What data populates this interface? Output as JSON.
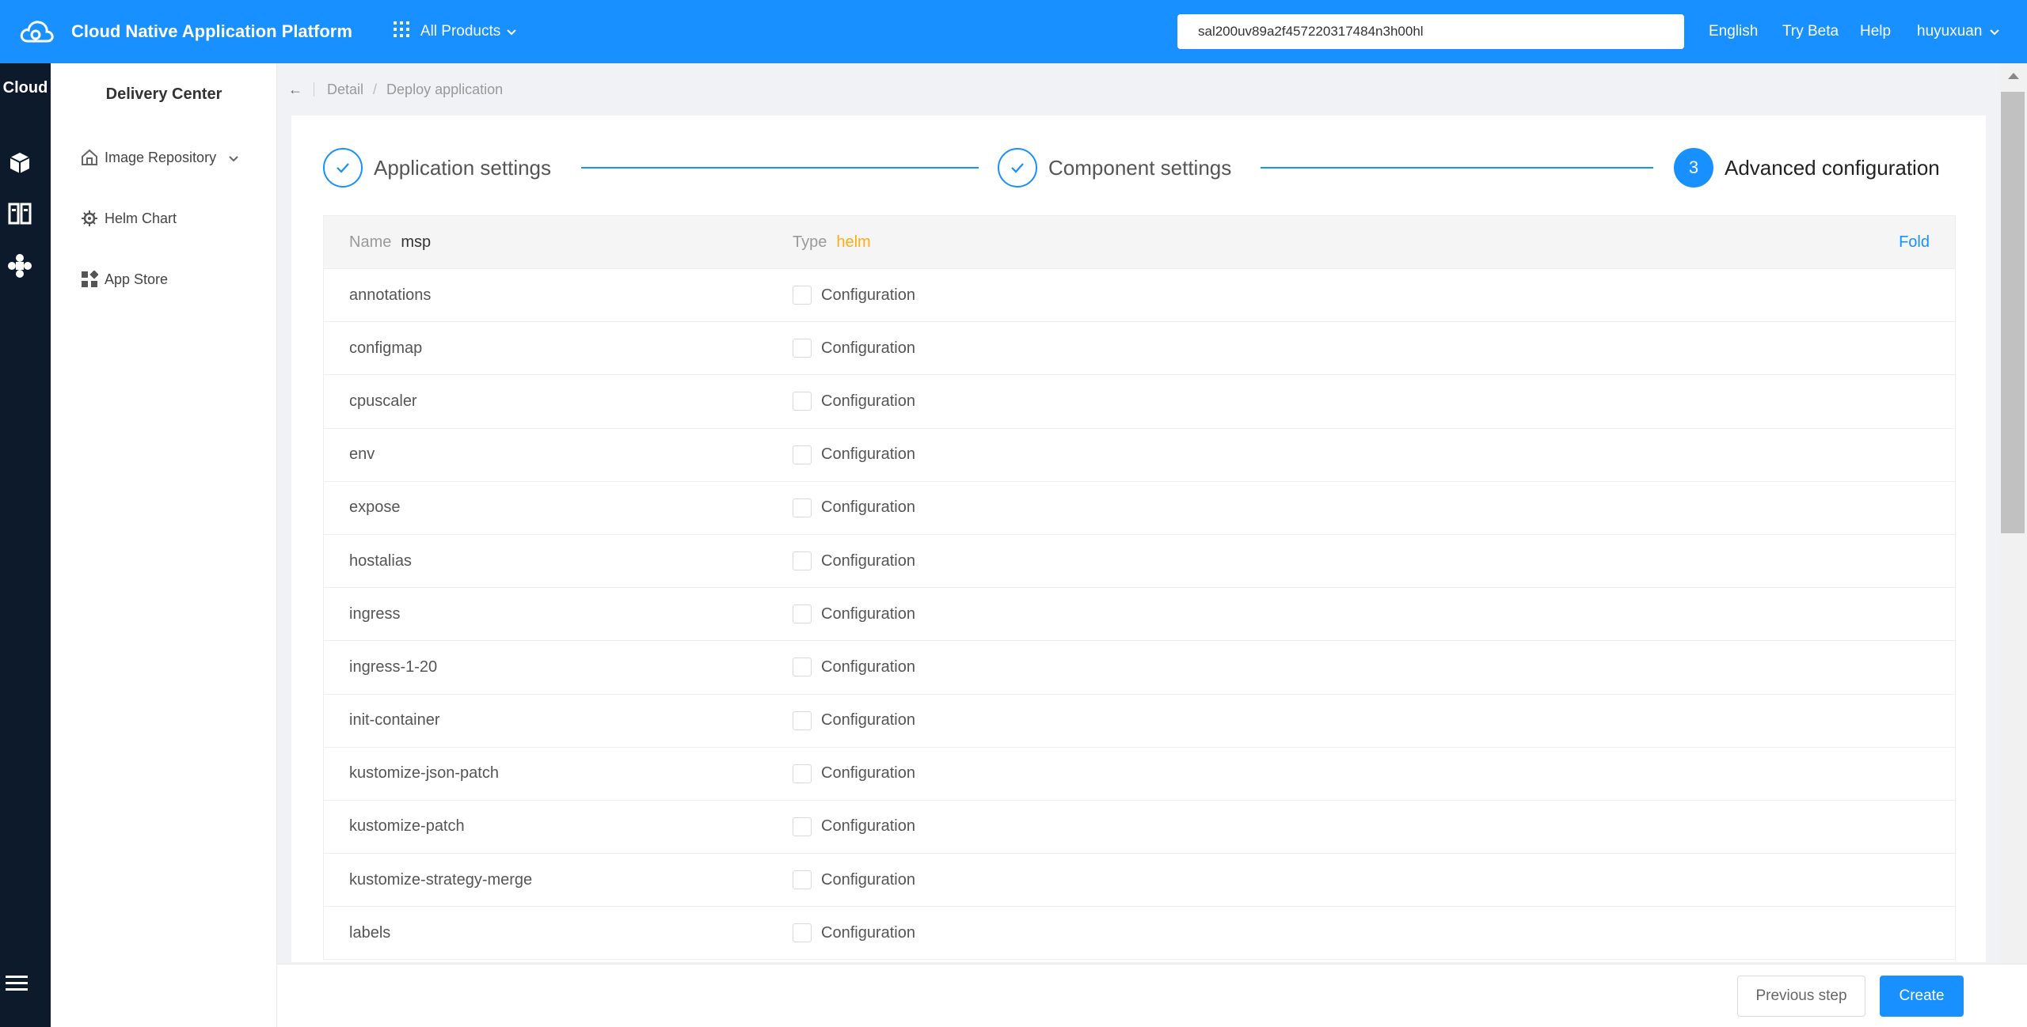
{
  "header": {
    "app_title": "Cloud Native Application Platform",
    "all_products_label": "All Products",
    "search_value": "sal200uv89a2f457220317484n3h00hl",
    "nav": {
      "language": "English",
      "try_beta": "Try Beta",
      "help": "Help",
      "user": "huyuxuan"
    }
  },
  "rail": {
    "brand": "Cloud"
  },
  "sidebar": {
    "title": "Delivery Center",
    "items": [
      {
        "label": "Image Repository",
        "icon": "home-repo-icon"
      },
      {
        "label": "Helm Chart",
        "icon": "helm-icon"
      },
      {
        "label": "App Store",
        "icon": "app-store-icon"
      }
    ]
  },
  "breadcrumb": {
    "back": "←",
    "items": [
      "Detail",
      "Deploy application"
    ],
    "separator": "/"
  },
  "steps": [
    {
      "label": "Application settings",
      "status": "done"
    },
    {
      "label": "Component settings",
      "status": "done"
    },
    {
      "number": "3",
      "label": "Advanced configuration",
      "status": "active"
    }
  ],
  "component": {
    "name_label": "Name",
    "name_value": "msp",
    "type_label": "Type",
    "type_value": "helm",
    "fold_label": "Fold",
    "config_label": "Configuration",
    "rows": [
      "annotations",
      "configmap",
      "cpuscaler",
      "env",
      "expose",
      "hostalias",
      "ingress",
      "ingress-1-20",
      "init-container",
      "kustomize-json-patch",
      "kustomize-patch",
      "kustomize-strategy-merge",
      "labels"
    ]
  },
  "footer": {
    "previous_label": "Previous step",
    "create_label": "Create"
  },
  "colors": {
    "primary": "#1890ff",
    "rail": "#0c1a2b",
    "type_accent": "#faad14"
  }
}
